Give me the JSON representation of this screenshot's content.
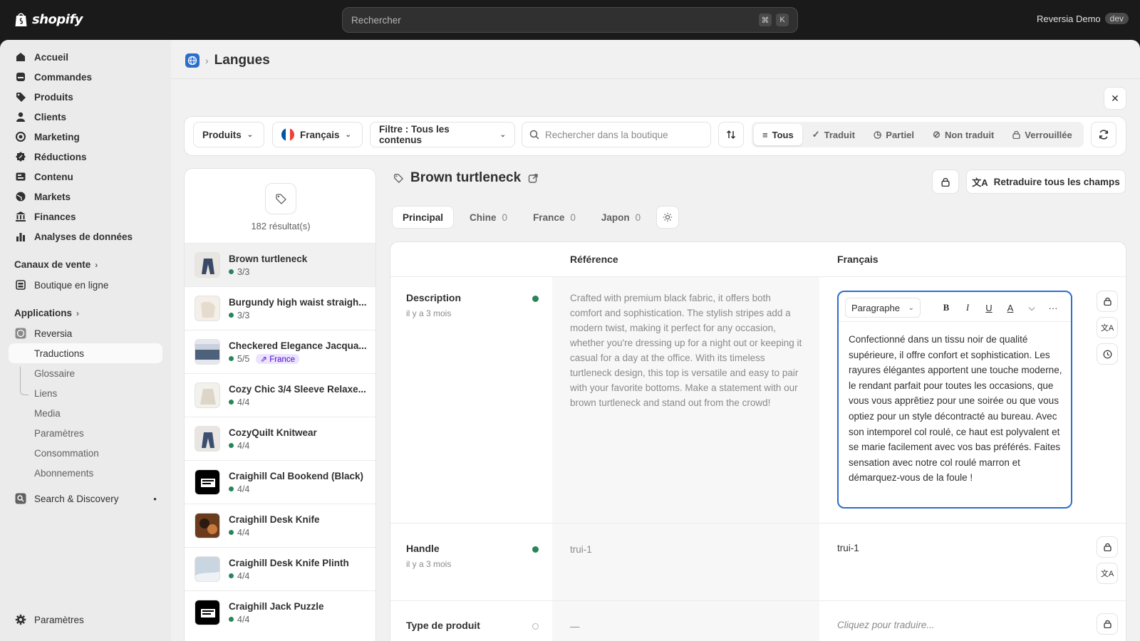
{
  "topbar": {
    "logo_text": "shopify",
    "search_placeholder": "Rechercher",
    "shortcut_keys": [
      "⌘",
      "K"
    ],
    "store_name": "Reversia Demo",
    "store_badge": "dev"
  },
  "sidebar": {
    "items": [
      {
        "label": "Accueil",
        "icon": "home-icon"
      },
      {
        "label": "Commandes",
        "icon": "orders-icon"
      },
      {
        "label": "Produits",
        "icon": "tag-icon"
      },
      {
        "label": "Clients",
        "icon": "person-icon"
      },
      {
        "label": "Marketing",
        "icon": "target-icon"
      },
      {
        "label": "Réductions",
        "icon": "discount-icon"
      },
      {
        "label": "Contenu",
        "icon": "content-icon"
      },
      {
        "label": "Markets",
        "icon": "globe-icon"
      },
      {
        "label": "Finances",
        "icon": "bank-icon"
      },
      {
        "label": "Analyses de données",
        "icon": "chart-bar-icon"
      }
    ],
    "sales_channels_label": "Canaux de vente",
    "online_store": "Boutique en ligne",
    "apps_label": "Applications",
    "app_name": "Reversia",
    "app_subitems": [
      "Traductions",
      "Glossaire",
      "Liens",
      "Media",
      "Paramètres",
      "Consommation",
      "Abonnements"
    ],
    "search_discovery": "Search & Discovery",
    "settings": "Paramètres"
  },
  "page": {
    "title": "Langues",
    "close": "✕"
  },
  "toolbar": {
    "resource": "Produits",
    "language": "Français",
    "filter": "Filtre : Tous les contenus",
    "search_placeholder": "Rechercher dans la boutique",
    "segments": [
      {
        "label": "Tous",
        "icon": "list-icon"
      },
      {
        "label": "Traduit",
        "icon": "check-icon"
      },
      {
        "label": "Partiel",
        "icon": "clock-icon"
      },
      {
        "label": "Non traduit",
        "icon": "slash-circle-icon"
      },
      {
        "label": "Verrouillée",
        "icon": "lock-icon"
      }
    ]
  },
  "results": {
    "count": "182 résultat(s)",
    "items": [
      {
        "title": "Brown turtleneck",
        "progress": "3/3",
        "market": ""
      },
      {
        "title": "Burgundy high waist straigh...",
        "progress": "3/3",
        "market": ""
      },
      {
        "title": "Checkered Elegance Jacqua...",
        "progress": "5/5",
        "market": "France"
      },
      {
        "title": "Cozy Chic 3/4 Sleeve Relaxe...",
        "progress": "4/4",
        "market": ""
      },
      {
        "title": "CozyQuilt Knitwear",
        "progress": "4/4",
        "market": ""
      },
      {
        "title": "Craighill Cal Bookend (Black)",
        "progress": "4/4",
        "market": ""
      },
      {
        "title": "Craighill Desk Knife",
        "progress": "4/4",
        "market": ""
      },
      {
        "title": "Craighill Desk Knife Plinth",
        "progress": "4/4",
        "market": ""
      },
      {
        "title": "Craighill Jack Puzzle",
        "progress": "4/4",
        "market": ""
      }
    ]
  },
  "product": {
    "title": "Brown turtleneck",
    "retranslate": "Retraduire tous les champs",
    "tabs": [
      {
        "label": "Principal",
        "count": ""
      },
      {
        "label": "Chine",
        "count": "0"
      },
      {
        "label": "France",
        "count": "0"
      },
      {
        "label": "Japon",
        "count": "0"
      }
    ]
  },
  "table": {
    "col_reference": "Référence",
    "col_language": "Français",
    "rows": [
      {
        "name": "Description",
        "time": "il y a 3 mois",
        "reference": "Crafted with premium black fabric, it offers both comfort and sophistication. The stylish stripes add a modern twist, making it perfect for any occasion, whether you're dressing up for a night out or keeping it casual for a day at the office. With its timeless turtleneck design, this top is versatile and easy to pair with your favorite bottoms. Make a statement with our brown turtleneck and stand out from the crowd!",
        "translation": "Confectionné dans un tissu noir de qualité supérieure, il offre confort et sophistication. Les rayures élégantes apportent une touche moderne, le rendant parfait pour toutes les occasions, que vous vous apprêtiez pour une soirée ou que vous optiez pour un style décontracté au bureau. Avec son intemporel col roulé, ce haut est polyvalent et se marie facilement avec vos bas préférés. Faites sensation avec notre col roulé marron et démarquez-vous de la foule !"
      },
      {
        "name": "Handle",
        "time": "il y a 3 mois",
        "reference": "trui-1",
        "translation": "trui-1"
      },
      {
        "name": "Type de produit",
        "time": "",
        "reference": "—",
        "translation": "Cliquez pour traduire..."
      }
    ],
    "editor_format": "Paragraphe"
  },
  "colors": {
    "accent": "#2c6ecb",
    "success": "#29845a",
    "topbar": "#1a1a1a"
  }
}
